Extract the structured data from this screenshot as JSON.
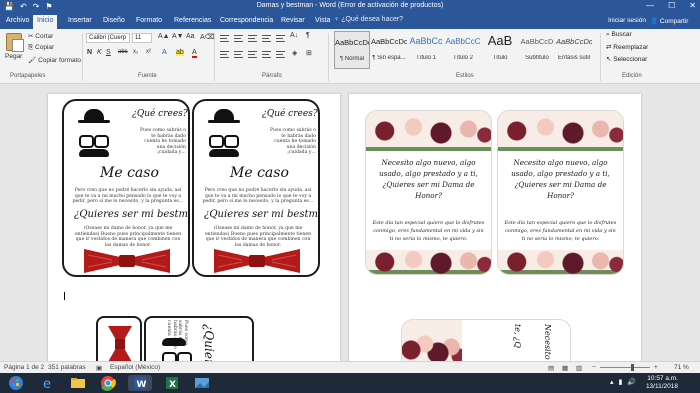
{
  "window": {
    "title": "Damas y bestman - Word (Error de activación de productos)",
    "quick_access": [
      "💾",
      "↶",
      "↷",
      "⚑"
    ],
    "controls": [
      "—",
      "☐",
      "✕"
    ]
  },
  "tabs": {
    "items": [
      "Archivo",
      "Inicio",
      "Insertar",
      "Diseño",
      "Formato",
      "Referencias",
      "Correspondencia",
      "Revisar",
      "Vista"
    ],
    "active": "Inicio",
    "search_placeholder": "¿Qué desea hacer?",
    "signin": "Iniciar sesión",
    "share": "Compartir"
  },
  "ribbon": {
    "clipboard": {
      "paste": "Pegar",
      "cut": "Cortar",
      "copy": "Copiar",
      "format_painter": "Copiar formato",
      "label": "Portapapeles"
    },
    "font": {
      "name": "Calibri (Cuerp",
      "size": "11",
      "label": "Fuente",
      "buttons": [
        "N",
        "K",
        "S",
        "abc",
        "x₂",
        "x²",
        "A",
        "A"
      ]
    },
    "paragraph": {
      "label": "Párrafo"
    },
    "styles": {
      "label": "Estilos",
      "items": [
        {
          "sample": "AaBbCcDc",
          "name": "¶ Normal"
        },
        {
          "sample": "AaBbCcDc",
          "name": "¶ Sin espa..."
        },
        {
          "sample": "AaBbCc",
          "name": "Título 1"
        },
        {
          "sample": "AaBbCcC",
          "name": "Título 2"
        },
        {
          "sample": "AaB",
          "name": "Título"
        },
        {
          "sample": "AaBbCcD",
          "name": "Subtítulo"
        },
        {
          "sample": "AaBbCcDc",
          "name": "Énfasis sutil"
        }
      ]
    },
    "editing": {
      "find": "Buscar",
      "replace": "Reemplazar",
      "select": "Seleccionar",
      "label": "Edición"
    }
  },
  "document": {
    "cards_best_man": {
      "question": "¿Qué crees?",
      "intro": "Pues como sabrás o te habrás dado cuenta he tomado una decisión ¡cuidada y…",
      "headline": "Me caso",
      "body": "Pero creo que no podré hacerlo sin ayuda, así que te va a mí mucho pensado lo que te voy a pedir, pero sí me lo necesito, y la pregunta es…",
      "ask": "¿Quieres ser mi bestman?",
      "footer": "(Osease mi damo de honor, ya que me entiendas) Bueno pues principalmente tienen que ir vestidos de manera que combinen con las damas de honor."
    },
    "cards_bridesmaid": {
      "text": "Necesito algo nuevo, algo usado, algo prestado y a ti, ¿Quieres ser mi Dama de Honor?",
      "footer": "Este día tan especial quiero que lo disfrutes conmigo, eres fundamental en mi vida y sin ti no sería lo mismo, te quiero."
    },
    "bottom_left_fragment": {
      "a": "Pues como sabrás o te habrás dado cuenta",
      "b": "¿Quieres"
    },
    "bottom_right_fragment": {
      "a": "Necesito",
      "b": "te, ¿Q"
    }
  },
  "status": {
    "page": "Página 1 de 2",
    "words": "351 palabras",
    "language": "Español (México)",
    "zoom": "71 %",
    "zoom_level_percent": 71
  },
  "taskbar": {
    "time": "10:57 a.m.",
    "date": "13/11/2018",
    "apps": [
      "windows-start",
      "ie",
      "explorer",
      "chrome",
      "word",
      "excel",
      "photos"
    ]
  },
  "colors": {
    "word_blue": "#2b579a",
    "bowtie_red": "#b31b1b",
    "burgundy": "#7a1f2e"
  }
}
